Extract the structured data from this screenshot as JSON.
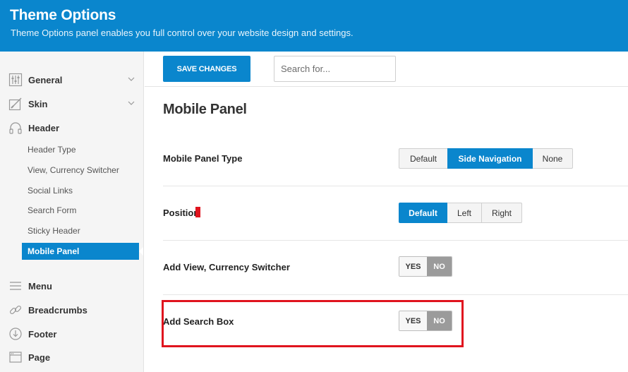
{
  "header": {
    "title": "Theme Options",
    "subtitle": "Theme Options panel enables you full control over your website design and settings."
  },
  "sidebar": {
    "items": [
      {
        "label": "General",
        "icon": "sliders-icon",
        "has_chevron": true
      },
      {
        "label": "Skin",
        "icon": "skin-icon",
        "has_chevron": true
      },
      {
        "label": "Header",
        "icon": "headphones-icon",
        "has_chevron": false
      },
      {
        "label": "Menu",
        "icon": "menu-icon",
        "has_chevron": false
      },
      {
        "label": "Breadcrumbs",
        "icon": "link-icon",
        "has_chevron": false
      },
      {
        "label": "Footer",
        "icon": "footer-icon",
        "has_chevron": false
      },
      {
        "label": "Page",
        "icon": "page-icon",
        "has_chevron": false
      }
    ],
    "header_subitems": [
      {
        "label": "Header Type"
      },
      {
        "label": "View, Currency Switcher"
      },
      {
        "label": "Social Links"
      },
      {
        "label": "Search Form"
      },
      {
        "label": "Sticky Header"
      },
      {
        "label": "Mobile Panel",
        "active": true
      }
    ]
  },
  "toolbar": {
    "save_label": "SAVE CHANGES",
    "search_placeholder": "Search for..."
  },
  "main": {
    "title": "Mobile Panel",
    "rows": [
      {
        "label": "Mobile Panel Type",
        "type": "segmented",
        "options": [
          "Default",
          "Side Navigation",
          "None"
        ],
        "selected": "Side Navigation"
      },
      {
        "label": "Position",
        "type": "segmented",
        "options": [
          "Default",
          "Left",
          "Right"
        ],
        "selected": "Default"
      },
      {
        "label": "Add View, Currency Switcher",
        "type": "toggle",
        "yes_label": "YES",
        "no_label": "NO",
        "value": "NO"
      },
      {
        "label": "Add Search Box",
        "type": "toggle",
        "yes_label": "YES",
        "no_label": "NO",
        "value": "NO"
      }
    ]
  },
  "colors": {
    "accent": "#0a86cd",
    "highlight": "#e0141e",
    "toggle_off": "#9b9b9b"
  }
}
